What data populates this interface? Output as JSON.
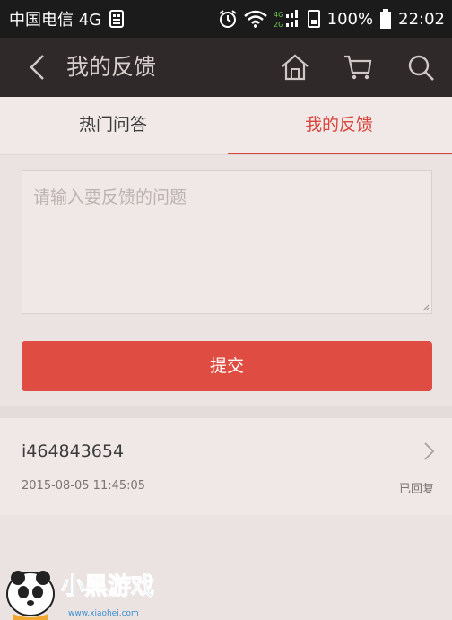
{
  "status_bar": {
    "carrier": "中国电信 4G",
    "battery": "100%",
    "time": "22:02"
  },
  "nav": {
    "title": "我的反馈",
    "icons": [
      "back-icon",
      "home-icon",
      "cart-icon",
      "search-icon"
    ]
  },
  "tabs": [
    {
      "label": "热门问答",
      "active": false
    },
    {
      "label": "我的反馈",
      "active": true
    }
  ],
  "feedback_form": {
    "placeholder": "请输入要反馈的问题",
    "value": "",
    "submit_label": "提交"
  },
  "feedback_list": [
    {
      "user": "i464843654",
      "time": "2015-08-05 11:45:05",
      "status": "已回复"
    }
  ],
  "watermark": {
    "brand": "小黑游戏",
    "url": "www.xiaohei.com"
  },
  "colors": {
    "accent": "#de4c42",
    "active_tab": "#d9453c",
    "navbar": "#2f2a29",
    "background": "#ebe3e1"
  }
}
